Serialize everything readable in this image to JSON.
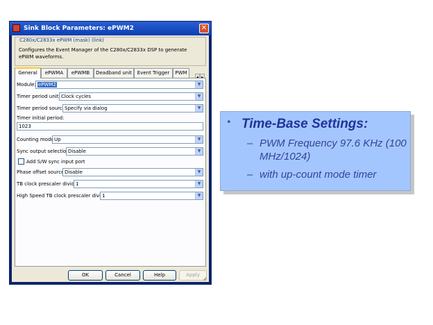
{
  "window": {
    "title": "Sink Block Parameters: ePWM2",
    "close_glyph": "✕"
  },
  "mask": {
    "title": "C280x/C2833x ePWM (mask) (link)",
    "description": "Configures the Event Manager of the C280x/C2833x DSP to generate ePWM waveforms."
  },
  "tabs": [
    "General",
    "ePWMA",
    "ePWMB",
    "Deadband unit",
    "Event Trigger",
    "PWM"
  ],
  "tab_arrows": [
    "◂",
    "▸"
  ],
  "fields": {
    "module": {
      "label": "Module:",
      "value": "ePWM2"
    },
    "timer_period_units": {
      "label": "Timer period units:",
      "value": "Clock cycles"
    },
    "timer_period_source": {
      "label": "Timer period source:",
      "value": "Specify via dialog"
    },
    "timer_initial_period": {
      "label": "Timer initial period:",
      "value": "1023"
    },
    "counting_mode": {
      "label": "Counting mode:",
      "value": "Up"
    },
    "sync_output_selection": {
      "label": "Sync output selection:",
      "value": "Disable"
    },
    "add_sync_input_port": {
      "label": "Add S/W sync input port",
      "checked": false
    },
    "phase_offset_source": {
      "label": "Phase offset source:",
      "value": "Disable"
    },
    "tb_clock_prescaler": {
      "label": "TB clock prescaler divider:",
      "value": "1"
    },
    "hs_tb_clock_prescaler": {
      "label": "High Speed TB clock prescaler divider:",
      "value": "1"
    }
  },
  "dropdown_glyph": "▼",
  "buttons": {
    "ok": "OK",
    "cancel": "Cancel",
    "help": "Help",
    "apply": "Apply"
  },
  "callout": {
    "bullet": "•",
    "heading": "Time-Base Settings:",
    "items": [
      {
        "dash": "–",
        "text": "PWM Frequency 97.6 KHz (100 MHz/1024)"
      },
      {
        "dash": "–",
        "text": "with up-count mode timer"
      }
    ]
  },
  "colors": {
    "title_bar": "#0b3fb3",
    "selection": "#316ac5",
    "callout_bg": "#a4c6ff",
    "callout_text": "#223399"
  }
}
